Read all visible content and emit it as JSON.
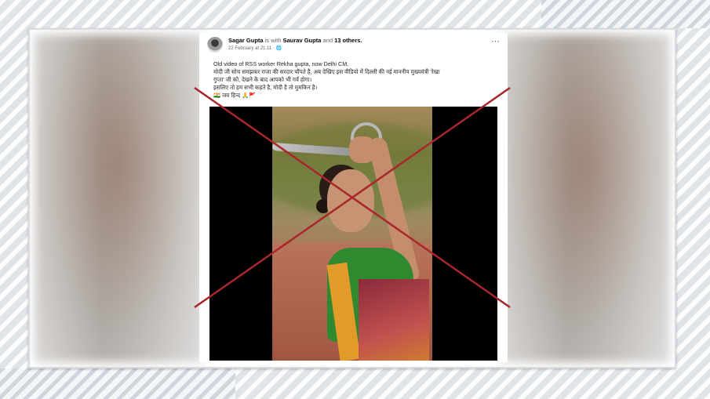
{
  "post": {
    "author": "Sagar Gupta",
    "with_text": "is with",
    "tagged": "Saurav Gupta",
    "and_text": "and",
    "others": "13 others.",
    "date": "22 February at 21:11 · 🌐",
    "more_icon": "⋯",
    "caption_lines": [
      "Old video of RSS worker Rekha gupta, now Delhi CM.",
      "मोदी जी सोच समझकर राजा की सरदार चौंपते है, अब देखिए इस वीडियो में दिल्ली की नई माननीय मुख्यमंत्री 'रेखा",
      "गुप्ता' जी को, देखने के बाद आपको भी गर्व होगा।",
      "इसलिए तो हम सभी कहते है, मोदी है तो मुमकिन है।",
      "🇮🇳 जय हिन्द 🙏🚩"
    ]
  },
  "colors": {
    "cross": "#a8262c",
    "link": "#050505"
  },
  "icons": {
    "avatar": "avatar",
    "more": "more-options-icon",
    "cross": "fact-check-cross-mark"
  }
}
